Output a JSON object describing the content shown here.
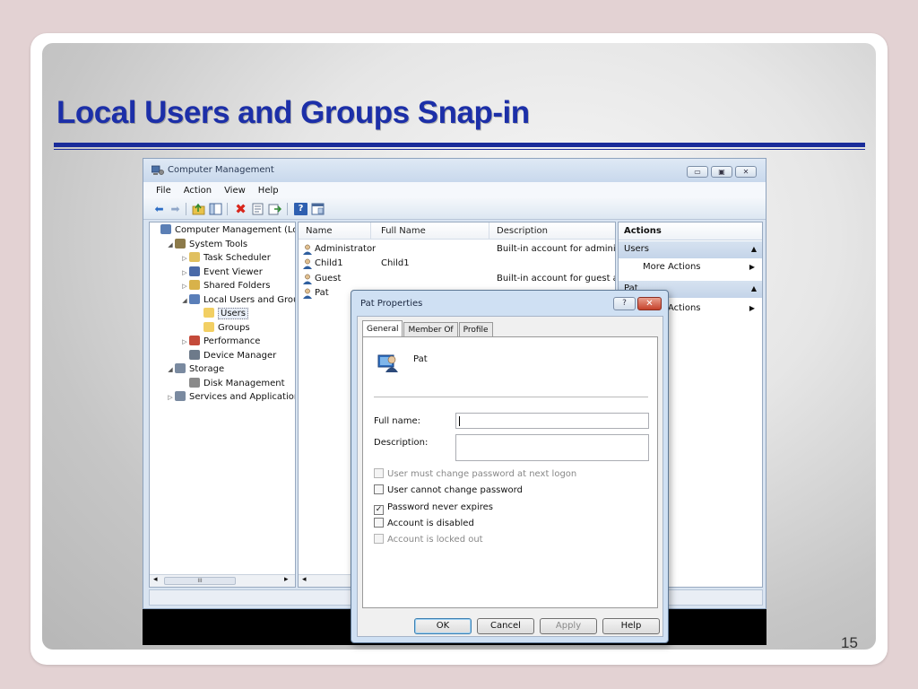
{
  "slide": {
    "title": "Local Users and Groups Snap-in",
    "page_number": "15"
  },
  "window": {
    "title": "Computer Management",
    "buttons": [
      "▭",
      "▣",
      "✕"
    ],
    "menu": [
      "File",
      "Action",
      "View",
      "Help"
    ],
    "toolbar_icons": [
      "back-arrow-icon",
      "forward-arrow-icon",
      "up-folder-icon",
      "show-hide-tree-icon",
      "delete-icon",
      "properties-icon",
      "export-icon",
      "help-icon",
      "console-icon"
    ]
  },
  "tree": [
    {
      "label": "Computer Management (Local",
      "indent": 0,
      "expander": "",
      "icon": "computer-icon",
      "color": "#5b7fb5"
    },
    {
      "label": "System Tools",
      "indent": 1,
      "expander": "◢",
      "icon": "tools-icon",
      "color": "#8c7a4a"
    },
    {
      "label": "Task Scheduler",
      "indent": 2,
      "expander": "▷",
      "icon": "clock-icon",
      "color": "#e0c060"
    },
    {
      "label": "Event Viewer",
      "indent": 2,
      "expander": "▷",
      "icon": "event-viewer-icon",
      "color": "#4a6aa8"
    },
    {
      "label": "Shared Folders",
      "indent": 2,
      "expander": "▷",
      "icon": "shared-folder-icon",
      "color": "#d8b24a"
    },
    {
      "label": "Local Users and Groups",
      "indent": 2,
      "expander": "◢",
      "icon": "users-groups-icon",
      "color": "#5a7eb8"
    },
    {
      "label": "Users",
      "indent": 3,
      "expander": "",
      "icon": "folder-icon",
      "color": "#f2cf63",
      "selected": true
    },
    {
      "label": "Groups",
      "indent": 3,
      "expander": "",
      "icon": "folder-icon",
      "color": "#f2cf63"
    },
    {
      "label": "Performance",
      "indent": 2,
      "expander": "▷",
      "icon": "performance-icon",
      "color": "#c44a3a"
    },
    {
      "label": "Device Manager",
      "indent": 2,
      "expander": "",
      "icon": "device-manager-icon",
      "color": "#6d7a8a"
    },
    {
      "label": "Storage",
      "indent": 1,
      "expander": "◢",
      "icon": "storage-icon",
      "color": "#7a8aa0"
    },
    {
      "label": "Disk Management",
      "indent": 2,
      "expander": "",
      "icon": "disk-icon",
      "color": "#8a8a8a"
    },
    {
      "label": "Services and Applications",
      "indent": 1,
      "expander": "▷",
      "icon": "services-icon",
      "color": "#7a8aa0"
    }
  ],
  "list": {
    "columns": [
      "Name",
      "Full Name",
      "Description"
    ],
    "rows": [
      {
        "name": "Administrator",
        "full_name": "",
        "description": "Built-in account for administ"
      },
      {
        "name": "Child1",
        "full_name": "Child1",
        "description": ""
      },
      {
        "name": "Guest",
        "full_name": "",
        "description": "Built-in account for guest ac"
      },
      {
        "name": "Pat",
        "full_name": "",
        "description": ""
      }
    ]
  },
  "actions": {
    "header": "Actions",
    "sections": [
      {
        "title": "Users",
        "items": [
          "More Actions"
        ]
      },
      {
        "title": "Pat",
        "items": [
          "More Actions"
        ]
      }
    ]
  },
  "scroll": {
    "left_thumb": "III",
    "left_arrow": "◂",
    "right_arrow": "▸"
  },
  "dialog": {
    "title": "Pat Properties",
    "help_button": "?",
    "close_button": "✕",
    "tabs": [
      "General",
      "Member Of",
      "Profile"
    ],
    "active_tab": 0,
    "user_name": "Pat",
    "fields": [
      {
        "label": "Full name:",
        "value": ""
      },
      {
        "label": "Description:",
        "value": ""
      }
    ],
    "checkboxes": [
      {
        "label": "User must change password at next logon",
        "checked": false,
        "enabled": false
      },
      {
        "label": "User cannot change password",
        "checked": false,
        "enabled": true
      },
      {
        "label": "Password never expires",
        "checked": true,
        "enabled": true
      },
      {
        "label": "Account is disabled",
        "checked": false,
        "enabled": true
      },
      {
        "label": "Account is locked out",
        "checked": false,
        "enabled": false
      }
    ],
    "buttons": [
      {
        "label": "OK",
        "enabled": true,
        "default": true
      },
      {
        "label": "Cancel",
        "enabled": true
      },
      {
        "label": "Apply",
        "enabled": false
      },
      {
        "label": "Help",
        "enabled": true
      }
    ]
  }
}
